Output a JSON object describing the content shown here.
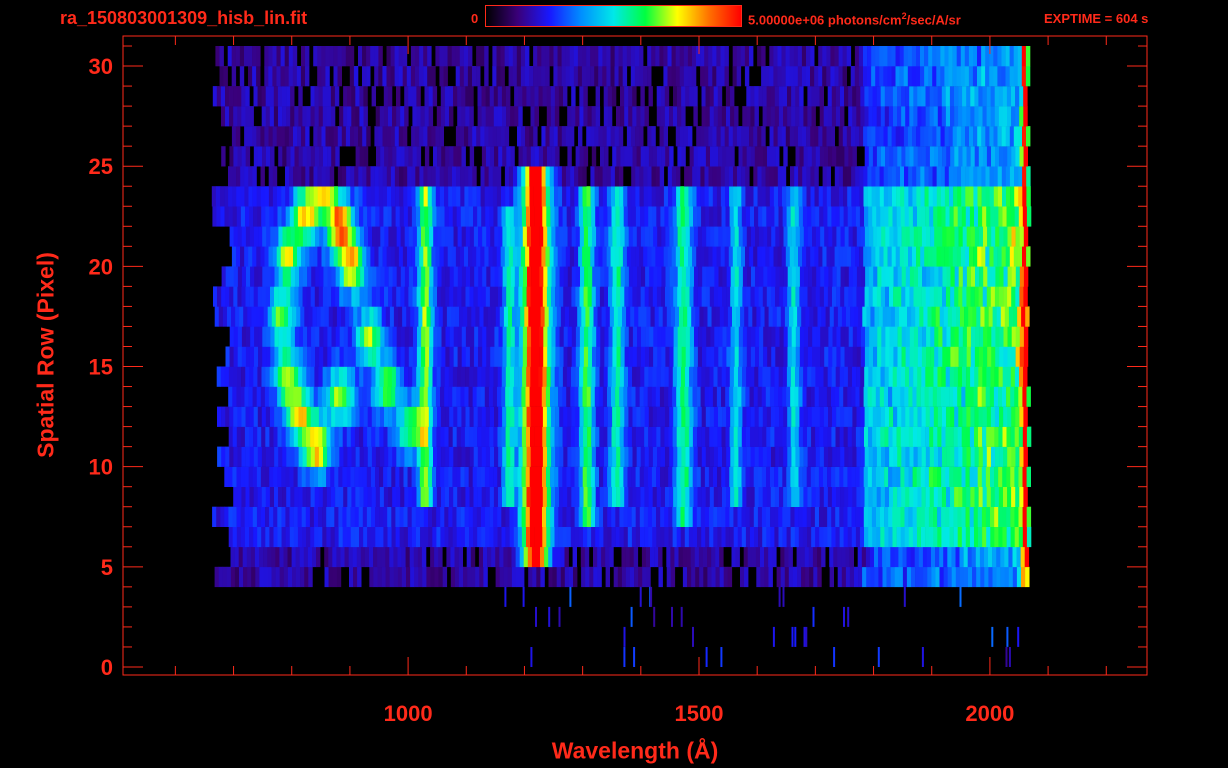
{
  "header": {
    "file_title": "ra_150803001309_hisb_lin.fit",
    "colorbar_min": "0",
    "colorbar_max_prefix": "5.00000e+06 photons/cm",
    "colorbar_max_sup": "2",
    "colorbar_max_suffix": "/sec/A/sr",
    "exptime": "EXPTIME = 604 s"
  },
  "colors": {
    "axis": "#ff2a1a",
    "background": "#000000",
    "colormap": [
      "#000000",
      "#3a007a",
      "#1818ff",
      "#0090ff",
      "#00e8e8",
      "#00ff40",
      "#ffff00",
      "#ff7000",
      "#ff0000"
    ]
  },
  "chart_data": {
    "type": "heatmap",
    "title": "ra_150803001309_hisb_lin.fit",
    "xlabel": "Wavelength (Å)",
    "ylabel": "Spatial Row (Pixel)",
    "xlim": [
      510,
      2270
    ],
    "ylim": [
      -0.4,
      31.5
    ],
    "x_ticks": [
      1000,
      1500,
      2000
    ],
    "y_ticks": [
      0,
      5,
      10,
      15,
      20,
      25,
      30
    ],
    "x_tick_labels": [
      "1000",
      "1500",
      "2000"
    ],
    "y_tick_labels": [
      "0",
      "5",
      "10",
      "15",
      "20",
      "25",
      "30"
    ],
    "grid": false,
    "colorbar": {
      "min": 0,
      "max": 5000000,
      "unit": "photons/cm^2/sec/A/sr",
      "position": "top"
    },
    "detector_range": [
      680,
      2060
    ],
    "signal_rows": [
      6,
      23
    ],
    "noise_rows": [
      4,
      30
    ],
    "emission_lines": [
      {
        "x": 1216,
        "intensity": 0.92,
        "width": 22,
        "rows": [
          5,
          24
        ]
      },
      {
        "x": 1026,
        "intensity": 0.45,
        "width": 12,
        "rows": [
          8,
          23
        ]
      },
      {
        "x": 1304,
        "intensity": 0.4,
        "width": 12,
        "rows": [
          7,
          23
        ]
      },
      {
        "x": 1356,
        "intensity": 0.32,
        "width": 12,
        "rows": [
          8,
          23
        ]
      },
      {
        "x": 1470,
        "intensity": 0.35,
        "width": 14,
        "rows": [
          7,
          23
        ]
      },
      {
        "x": 1170,
        "intensity": 0.3,
        "width": 10,
        "rows": [
          8,
          22
        ]
      },
      {
        "x": 1560,
        "intensity": 0.25,
        "width": 10,
        "rows": [
          8,
          23
        ]
      },
      {
        "x": 1660,
        "intensity": 0.25,
        "width": 10,
        "rows": [
          8,
          23
        ]
      },
      {
        "x": 2058,
        "intensity": 0.75,
        "width": 6,
        "rows": [
          2,
          30
        ]
      }
    ],
    "rising_continuum": {
      "start": 1780,
      "end": 2060,
      "intensity": 0.45
    },
    "structure": [
      {
        "x": 850,
        "y": 23.5,
        "intensity": 0.55
      },
      {
        "x": 880,
        "y": 21.5,
        "intensity": 0.75
      },
      {
        "x": 900,
        "y": 19.5,
        "intensity": 0.6
      },
      {
        "x": 820,
        "y": 22,
        "intensity": 0.55
      },
      {
        "x": 790,
        "y": 20,
        "intensity": 0.5
      },
      {
        "x": 780,
        "y": 17,
        "intensity": 0.45
      },
      {
        "x": 790,
        "y": 14,
        "intensity": 0.5
      },
      {
        "x": 810,
        "y": 12,
        "intensity": 0.55
      },
      {
        "x": 840,
        "y": 10.5,
        "intensity": 0.6
      },
      {
        "x": 880,
        "y": 13,
        "intensity": 0.5
      },
      {
        "x": 930,
        "y": 16,
        "intensity": 0.45
      },
      {
        "x": 960,
        "y": 13.5,
        "intensity": 0.45
      },
      {
        "x": 1000,
        "y": 11.5,
        "intensity": 0.4
      }
    ]
  }
}
